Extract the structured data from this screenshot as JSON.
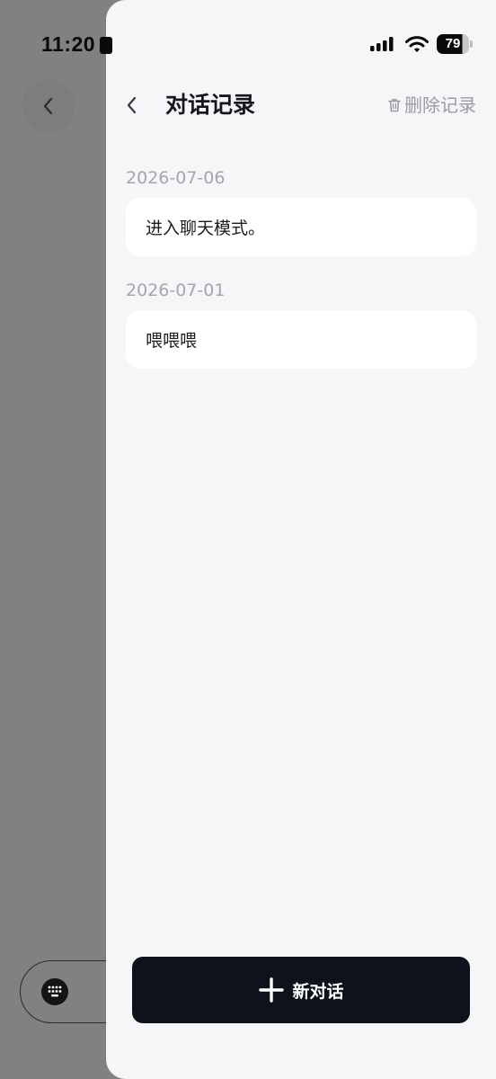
{
  "status_bar": {
    "time": "11:20",
    "battery": "79"
  },
  "header": {
    "title": "对话记录",
    "delete_label": "删除记录"
  },
  "history": [
    {
      "date": "2026-07-06",
      "message": "进入聊天模式。"
    },
    {
      "date": "2026-07-01",
      "message": "喂喂喂"
    }
  ],
  "footer": {
    "new_chat_label": "新对话"
  },
  "icons": {
    "back": "chevron-left-icon",
    "delete": "trash-icon",
    "new_chat": "plus-icon",
    "keyboard": "keyboard-icon"
  },
  "colors": {
    "drawer_bg": "#f5f6f8",
    "overlay": "#818181",
    "primary_button": "#0e121b",
    "muted_text": "#9a9ca1"
  }
}
